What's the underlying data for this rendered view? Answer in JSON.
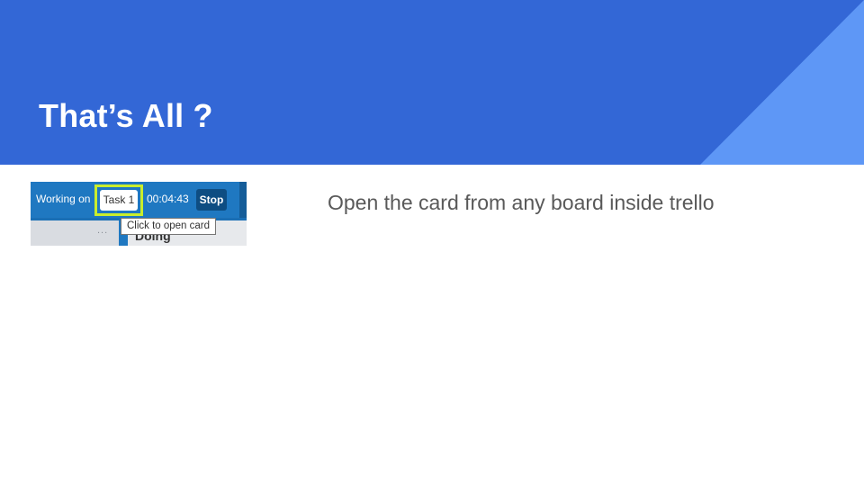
{
  "slide": {
    "title": "That’s All ?",
    "body": "Open the card from any board inside trello"
  },
  "screenshot": {
    "working_label": "Working on",
    "task_label": "Task 1",
    "timer": "00:04:43",
    "stop_label": "Stop",
    "tooltip": "Click to open card",
    "list_name": "Doing",
    "menu_dots": "..."
  },
  "colors": {
    "header": "#3367d6",
    "header_accent": "#5e97f6",
    "header_accent_dark": "#3d75d9",
    "body_text": "#595959",
    "highlight": "#c9ee2c",
    "toolbar": "#1f78c1"
  }
}
